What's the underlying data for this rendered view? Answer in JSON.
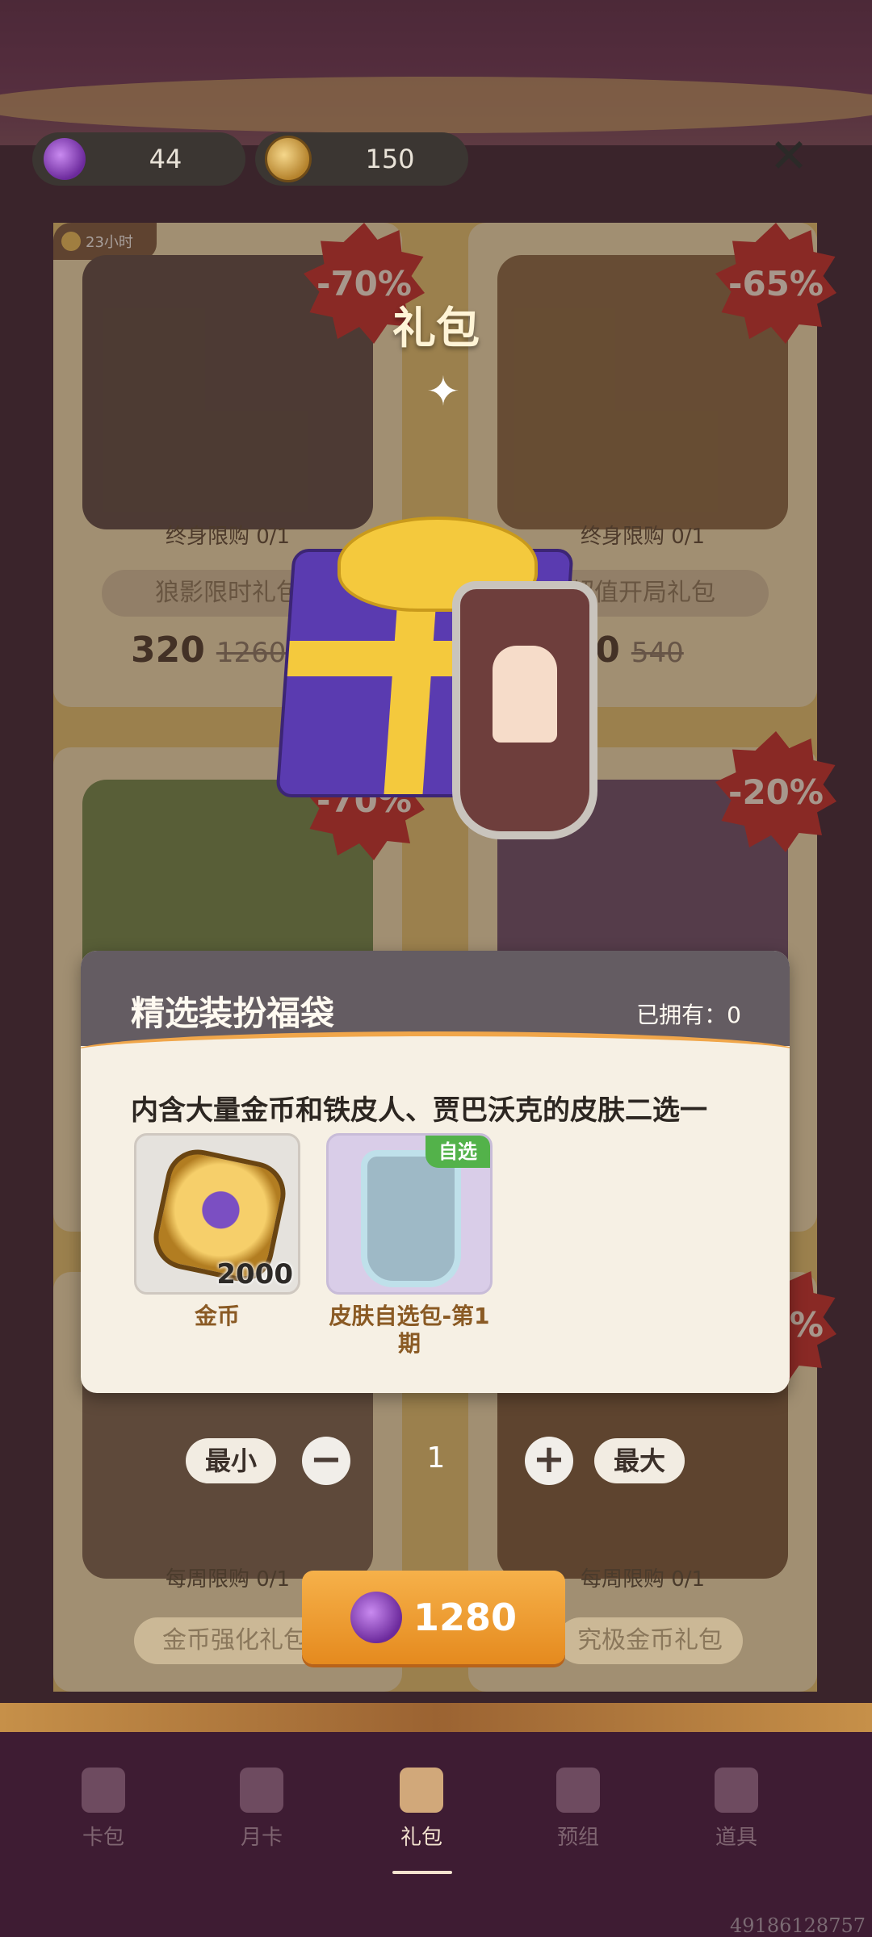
{
  "currency": {
    "candy": "44",
    "coins": "150"
  },
  "shop": {
    "timer": "23小时",
    "cards": [
      {
        "discount": "-70%",
        "limit": "终身限购 0/1",
        "name": "狼影限时礼包",
        "price": "320",
        "old_price": "1260"
      },
      {
        "discount": "-65%",
        "limit": "终身限购 0/1",
        "name": "超值开局礼包",
        "price": "180",
        "old_price": "540"
      },
      {
        "discount": "-70%"
      },
      {
        "discount": "-20%"
      },
      {
        "limit": "每周限购 0/1",
        "name": "金币强化礼包"
      },
      {
        "discount": "-70%",
        "limit": "每周限购 0/1",
        "name": "究极金币礼包"
      }
    ]
  },
  "reveal": {
    "title": "礼包"
  },
  "panel": {
    "title": "精选装扮福袋",
    "owned": "已拥有：0",
    "description": "内含大量金币和铁皮人、贾巴沃克的皮肤二选一",
    "items": [
      {
        "label": "金币",
        "quantity": "2000"
      },
      {
        "label": "皮肤自选包-第1期",
        "tag": "自选"
      }
    ]
  },
  "quantity": {
    "min_label": "最小",
    "max_label": "最大",
    "value": "1",
    "minus": "−",
    "plus": "+"
  },
  "buy": {
    "price": "1280"
  },
  "nav": {
    "tabs": [
      "卡包",
      "月卡",
      "礼包",
      "预组",
      "道具"
    ],
    "active": "礼包"
  },
  "watermark": "49186128757",
  "colors": {
    "accent_orange": "#E58A1E",
    "sale_red": "#C92B2B",
    "tag_green": "#53B24A",
    "nav_bg": "#3E1C33"
  },
  "icons": [
    "candy-icon",
    "coin-icon",
    "close-icon",
    "sparkle-icon",
    "gift-box-icon",
    "armor-shield-icon"
  ]
}
